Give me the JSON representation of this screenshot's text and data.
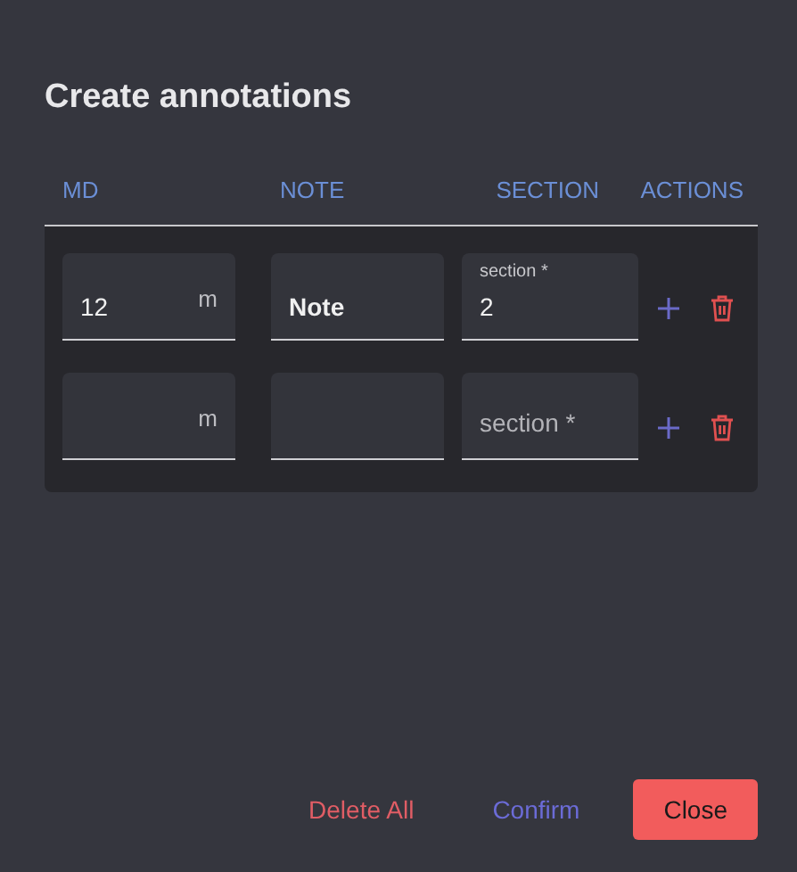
{
  "dialog": {
    "title": "Create annotations"
  },
  "table": {
    "columns": [
      "MD",
      "NOTE",
      "SECTION",
      "ACTIONS"
    ],
    "rows": [
      {
        "md": {
          "value": "12",
          "unit": "m"
        },
        "note": {
          "value": "Note"
        },
        "section": {
          "label": "section *",
          "value": "2"
        }
      },
      {
        "md": {
          "unit": "m"
        },
        "note": {},
        "section": {
          "placeholder": "section *"
        }
      }
    ]
  },
  "buttons": [
    {
      "label": "Delete All",
      "kind": "danger"
    },
    {
      "label": "Confirm",
      "kind": "primary"
    },
    {
      "label": "Close",
      "kind": "filled"
    }
  ]
}
